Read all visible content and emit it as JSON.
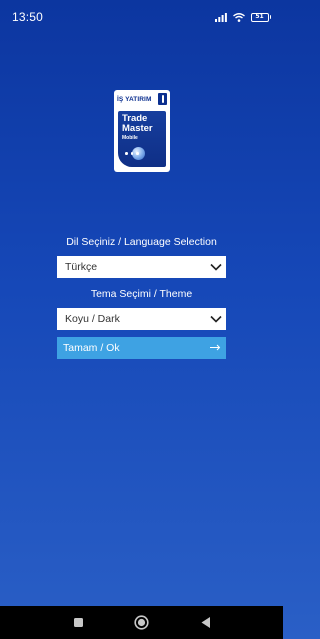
{
  "status_bar": {
    "time": "13:50",
    "battery_level": "51",
    "icons": [
      "signal-icon",
      "wifi-icon",
      "battery-icon"
    ]
  },
  "logo": {
    "brand": "İŞ YATIRIM",
    "product_line1": "Trade",
    "product_line2": "Master",
    "product_sub": "Mobile"
  },
  "language": {
    "label": "Dil Seçiniz / Language Selection",
    "selected": "Türkçe"
  },
  "theme": {
    "label": "Tema Seçimi / Theme",
    "selected": "Koyu / Dark"
  },
  "confirm": {
    "label": "Tamam / Ok",
    "icon": "arrow-right-icon"
  },
  "nav_bar": {
    "icons": [
      "recents-icon",
      "home-icon",
      "back-icon"
    ]
  },
  "colors": {
    "background_top": "#0c36a0",
    "background_bottom": "#2a5fc6",
    "button": "#3ea2e3",
    "select_bg": "#ffffff",
    "nav_bar": "#000000"
  }
}
